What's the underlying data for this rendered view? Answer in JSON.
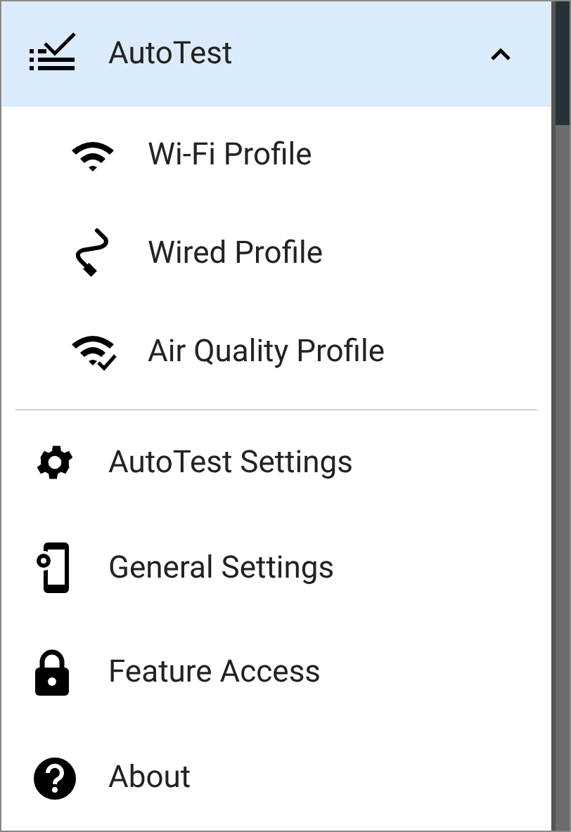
{
  "header": {
    "label": "AutoTest",
    "expanded": true
  },
  "profiles": [
    {
      "label": "Wi-Fi Profile"
    },
    {
      "label": "Wired Profile"
    },
    {
      "label": "Air Quality Profile"
    }
  ],
  "menu": [
    {
      "label": "AutoTest Settings"
    },
    {
      "label": "General Settings"
    },
    {
      "label": "Feature Access"
    },
    {
      "label": "About"
    }
  ]
}
